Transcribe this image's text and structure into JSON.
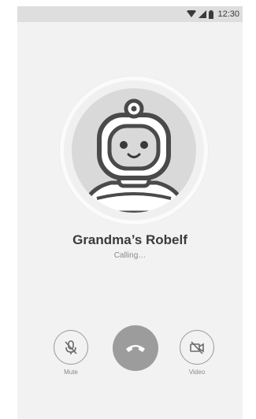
{
  "status_bar": {
    "time": "12:30",
    "icons": [
      "wifi-icon",
      "signal-icon",
      "battery-icon"
    ]
  },
  "contact": {
    "name": "Grandma’s Robelf",
    "call_status": "Calling…",
    "avatar": "robot-avatar-icon"
  },
  "controls": {
    "mute_label": "Mute",
    "video_label": "Video",
    "end_call_icon": "phone-hangup-icon",
    "mute_icon": "mic-off-icon",
    "video_icon": "video-off-icon"
  },
  "colors": {
    "background": "#f2f2f2",
    "status_bar": "#dedede",
    "end_call_button": "#9c9c9c",
    "avatar_bg": "#d9d9d9"
  }
}
